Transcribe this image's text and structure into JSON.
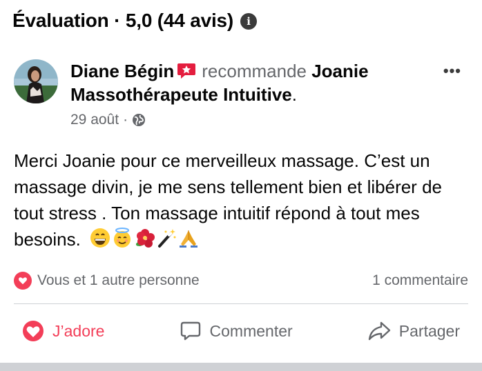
{
  "header": {
    "title": "Évaluation · 5,0 (44 avis)",
    "info_icon": "info-circle-icon"
  },
  "post": {
    "author": "Diane Bégin",
    "recommend_badge_icon": "recommend-badge-icon",
    "recommend_text": "recommande",
    "page_name": "Joanie Massothérapeute Intuitive",
    "page_suffix": ".",
    "date": "29 août",
    "separator": "·",
    "audience_icon": "globe-icon",
    "more_icon": "•••",
    "body": "Merci Joanie pour ce merveilleux massage. C’est un massage divin, je me sens tellement bien et libérer de tout stress . Ton massage intuitif répond à tout mes besoins.",
    "emojis": [
      "grinning-face",
      "smiling-face-with-halo",
      "hibiscus",
      "magic-wand",
      "folded-hands"
    ]
  },
  "stats": {
    "reaction_icon": "heart-reaction-icon",
    "reactions_text": "Vous et 1 autre personne",
    "comments_text": "1 commentaire"
  },
  "actions": {
    "love_label": "J’adore",
    "comment_label": "Commenter",
    "share_label": "Partager"
  },
  "colors": {
    "love": "#f33e58",
    "secondary_text": "#65676b",
    "badge": "#e41e3f"
  }
}
